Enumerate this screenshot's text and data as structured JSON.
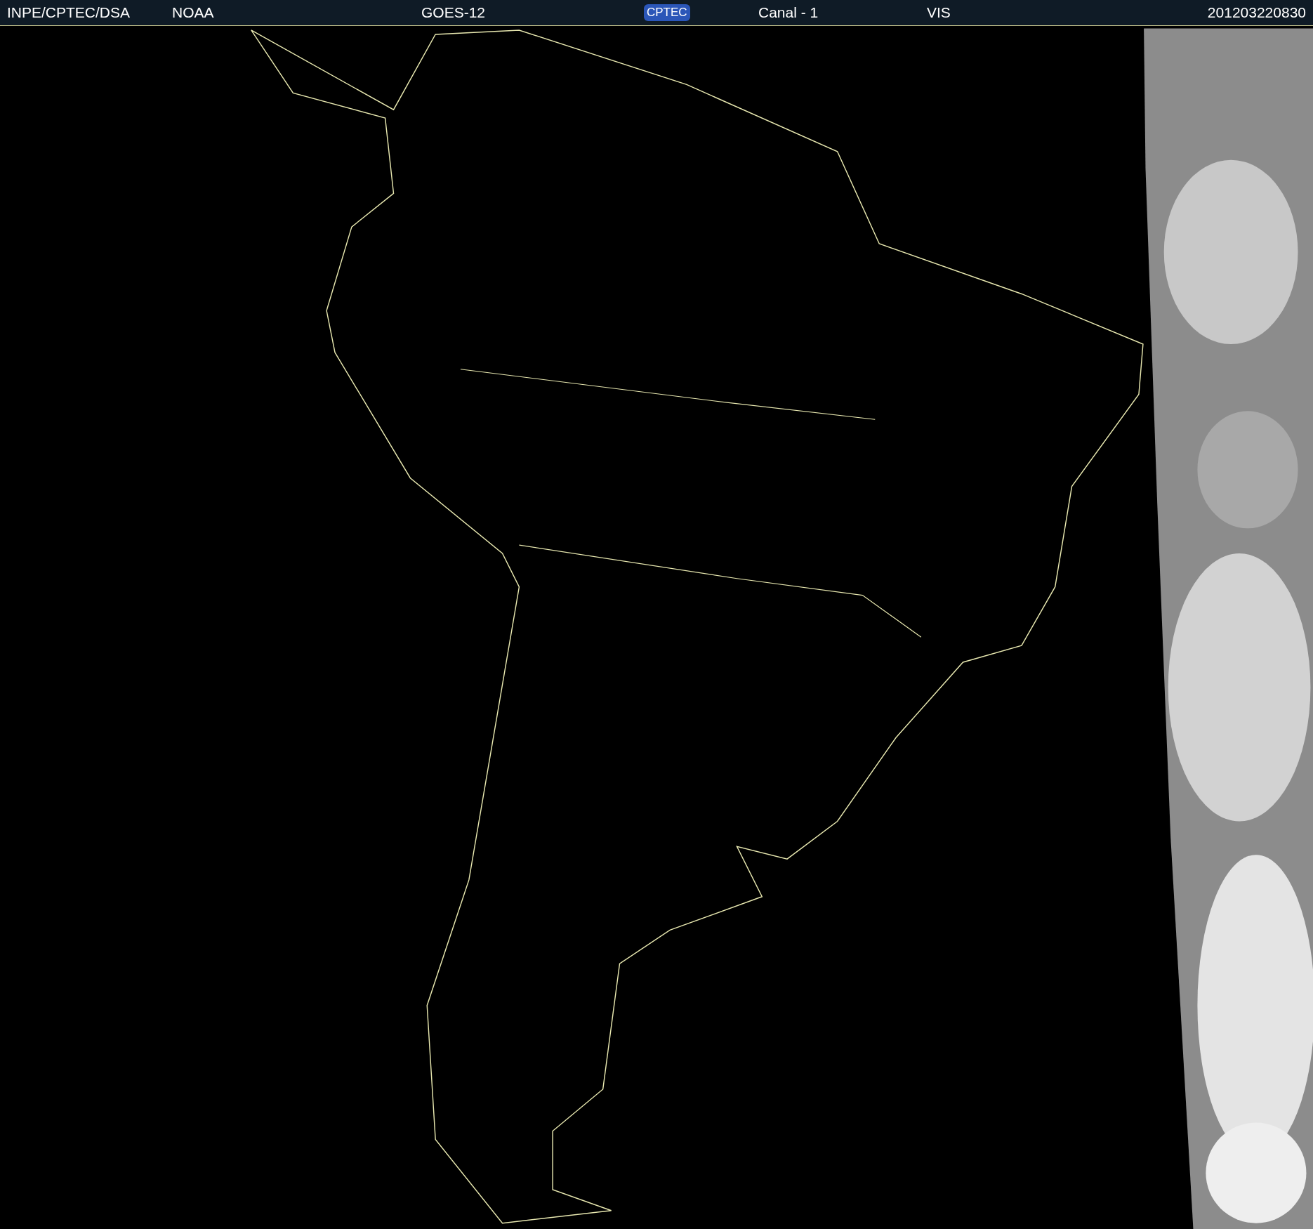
{
  "header": {
    "source": "INPE/CPTEC/DSA",
    "agency": "NOAA",
    "satellite": "GOES-12",
    "logo": "CPTEC",
    "channel": "Canal - 1",
    "band": "VIS",
    "timestamp": "201203220830"
  }
}
